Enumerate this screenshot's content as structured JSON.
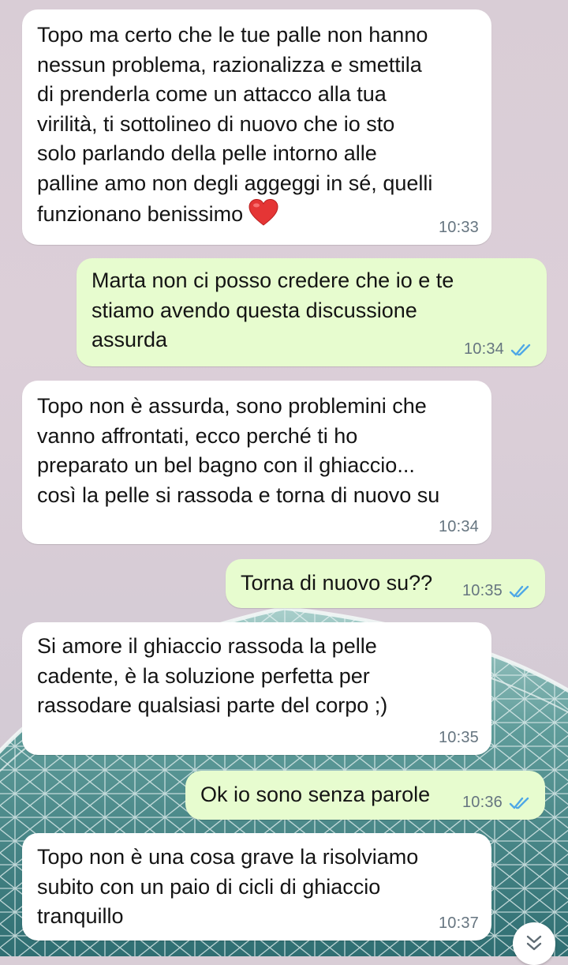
{
  "messages": [
    {
      "direction": "incoming",
      "text": "Topo ma certo che le tue palle non hanno\nnessun problema, razionalizza e smettila\ndi prenderla come un attacco alla tua\nvirilità, ti sottolineo di nuovo che io sto\nsolo parlando della pelle intorno alle\npalline amo non degli aggeggi in sé, quelli\nfunzionano benissimo",
      "emoji": "heart-icon",
      "time": "10:33"
    },
    {
      "direction": "outgoing",
      "text": "Marta non ci posso credere che io e te\nstiamo avendo questa discussione\nassurda",
      "time": "10:34",
      "status": "read"
    },
    {
      "direction": "incoming",
      "text": "Topo non è assurda, sono problemini che\nvanno affrontati, ecco perché ti ho\npreparato un bel bagno con il ghiaccio...\ncosì la pelle si rassoda e torna di nuovo su",
      "time": "10:34"
    },
    {
      "direction": "outgoing",
      "text": "Torna di nuovo su??",
      "time": "10:35",
      "status": "read"
    },
    {
      "direction": "incoming",
      "text": "Si amore il ghiaccio rassoda la pelle\ncadente, è la soluzione perfetta per\nrassodare qualsiasi parte del corpo ;)",
      "time": "10:35"
    },
    {
      "direction": "outgoing",
      "text": "Ok io sono senza parole",
      "time": "10:36",
      "status": "read"
    },
    {
      "direction": "incoming",
      "text": "Topo non è una cosa grave la risolviamo\nsubito con un paio di cicli di ghiaccio\ntranquillo",
      "time": "10:37"
    }
  ],
  "colors": {
    "incoming_bubble": "#ffffff",
    "outgoing_bubble": "#e7fccf",
    "read_ticks": "#4fa8e6",
    "timestamp": "#667580"
  },
  "scroll_button": {
    "icon": "double-chevron-down-icon"
  }
}
